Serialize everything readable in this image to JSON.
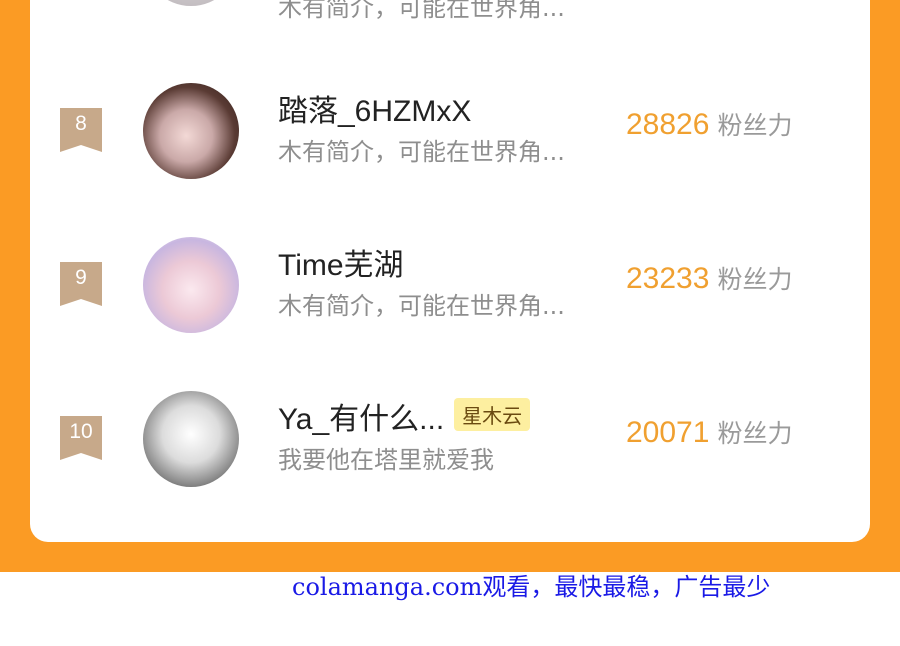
{
  "rows": [
    {
      "rank": "",
      "name": "",
      "tag": "",
      "bio": "木有简介，可能在世界角...",
      "fans": "",
      "fans_unit": ""
    },
    {
      "rank": "8",
      "name": "踏落_6HZMxX",
      "tag": "",
      "bio": "木有简介，可能在世界角...",
      "fans": "28826",
      "fans_unit": "粉丝力"
    },
    {
      "rank": "9",
      "name": "Time芜湖",
      "tag": "",
      "bio": "木有简介，可能在世界角...",
      "fans": "23233",
      "fans_unit": "粉丝力"
    },
    {
      "rank": "10",
      "name": "Ya_有什么...",
      "tag": "星木云",
      "bio": "我要他在塔里就爱我",
      "fans": "20071",
      "fans_unit": "粉丝力"
    }
  ],
  "watermark": "colamanga.com观看，最快最稳，广告最少",
  "colors": {
    "frame": "#FB9B24",
    "fans": "#F0A030",
    "rank_badge": "#C7A98A",
    "watermark": "#1A1AE6"
  }
}
